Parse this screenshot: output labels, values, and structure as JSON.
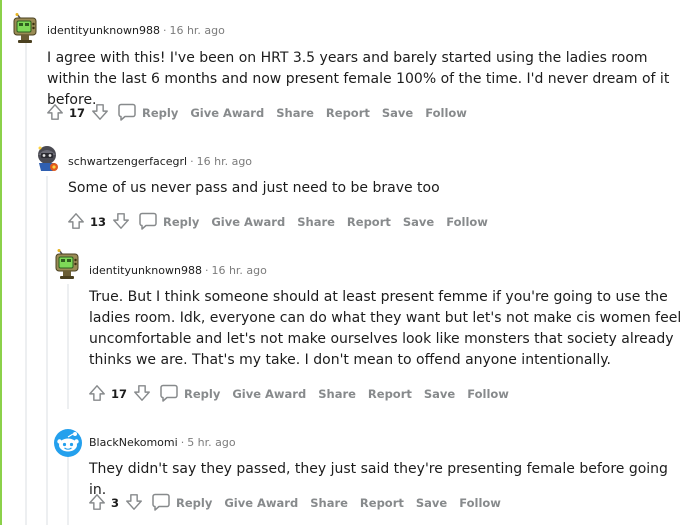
{
  "colors": {
    "thread_line_green": "#8bd14a",
    "thread_line_gray": "#edeff1",
    "action_gray": "#878a8c",
    "meta_gray": "#7c7c7c"
  },
  "comments": [
    {
      "author": "identityunknown988",
      "time": "16 hr. ago",
      "avatar_icon": "tv-robot-avatar-icon",
      "body": "I agree with this! I've been on HRT 3.5 years and barely started using the ladies room within the last 6 months and now present female 100% of the time. I'd never dream of it before.",
      "score": "17",
      "actions": {
        "reply": "Reply",
        "give_award": "Give Award",
        "share": "Share",
        "report": "Report",
        "save": "Save",
        "follow": "Follow"
      }
    },
    {
      "author": "schwartzengerfacegrl",
      "time": "16 hr. ago",
      "avatar_icon": "armored-avatar-icon",
      "body": "Some of us never pass and just need to be brave too",
      "score": "13",
      "actions": {
        "reply": "Reply",
        "give_award": "Give Award",
        "share": "Share",
        "report": "Report",
        "save": "Save",
        "follow": "Follow"
      }
    },
    {
      "author": "identityunknown988",
      "time": "16 hr. ago",
      "avatar_icon": "tv-robot-avatar-icon",
      "body": "True. But I think someone should at least present femme if you're going to use the ladies room. Idk, everyone can do what they want but let's not make cis women feel uncomfortable and let's not make ourselves look like monsters that society already thinks we are. That's my take. I don't mean to offend anyone intentionally.",
      "score": "17",
      "actions": {
        "reply": "Reply",
        "give_award": "Give Award",
        "share": "Share",
        "report": "Report",
        "save": "Save",
        "follow": "Follow"
      }
    },
    {
      "author": "BlackNekomomi",
      "time": "5 hr. ago",
      "avatar_icon": "snoo-default-avatar-icon",
      "body": "They didn't say they passed, they just said they're presenting female before going in.",
      "score": "3",
      "actions": {
        "reply": "Reply",
        "give_award": "Give Award",
        "share": "Share",
        "report": "Report",
        "save": "Save",
        "follow": "Follow"
      }
    }
  ]
}
